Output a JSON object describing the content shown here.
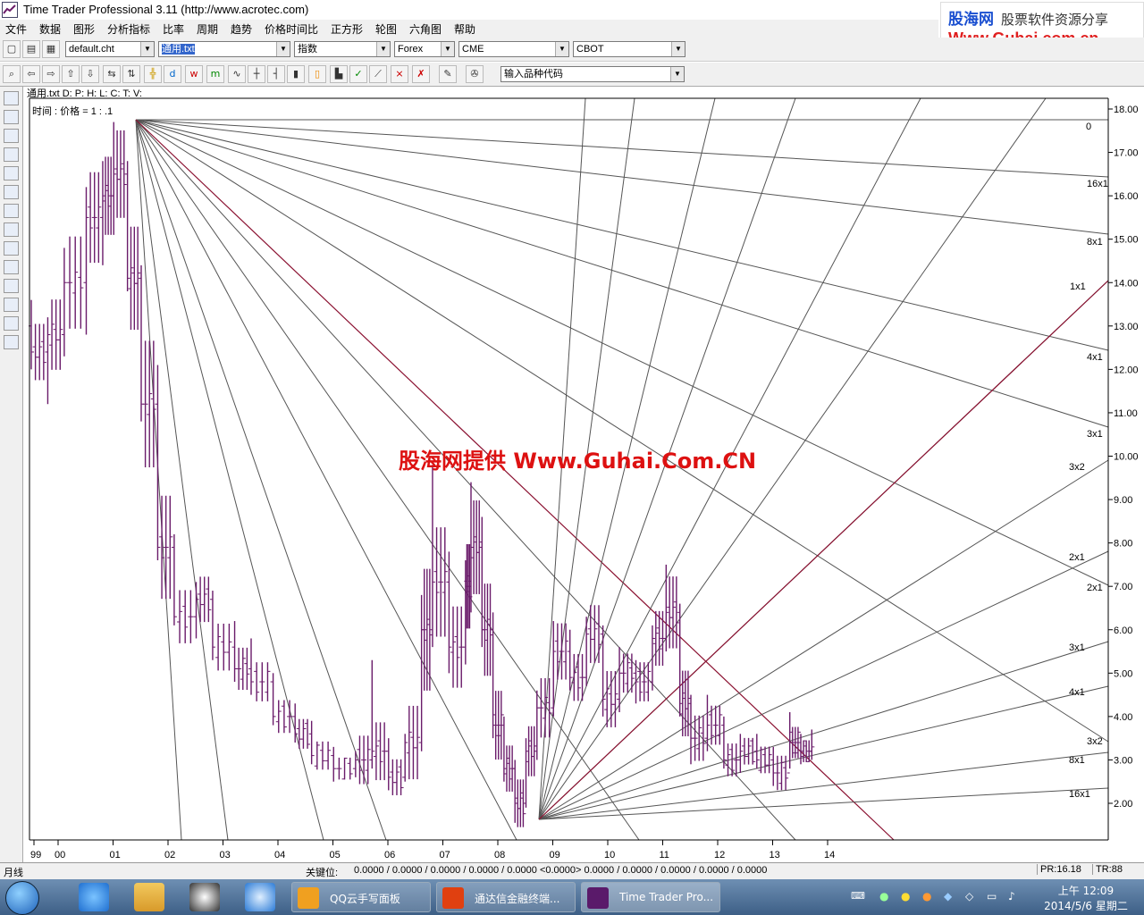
{
  "window": {
    "title": "Time Trader Professional 3.11 (http://www.acrotec.com)"
  },
  "ad": {
    "line1": "股海网",
    "line1b": "股票软件资源分享",
    "line2": "Www.Guhai.com.cn"
  },
  "menu": [
    "文件",
    "数据",
    "图形",
    "分析指标",
    "比率",
    "周期",
    "趋势",
    "价格时间比",
    "正方形",
    "轮图",
    "六角图",
    "帮助"
  ],
  "toolbar1": {
    "chart_file": "default.cht",
    "data_file": "通用.txt",
    "index": "指数",
    "market1": "Forex",
    "market2": "CME",
    "market3": "CBOT"
  },
  "toolbar2": {
    "symbol_input": "输入品种代码"
  },
  "info": {
    "data_line": "通用.txt  D:   P:   H:   L:   C:   T:   V:",
    "ratio_line": "时间 : 价格  = 1 :      .1"
  },
  "watermark": "股海网提供 Www.Guhai.Com.CN",
  "status": {
    "period": "月线",
    "key_label": "关键位:",
    "key_values": "0.0000 / 0.0000 / 0.0000 / 0.0000 / 0.0000 <0.0000> 0.0000 / 0.0000 / 0.0000 / 0.0000 / 0.0000",
    "pr": "PR:16.18",
    "tr": "TR:88"
  },
  "taskbar": {
    "tasks": [
      "QQ云手写面板",
      "通达信金融终端...",
      "Time Trader Pro..."
    ],
    "time": "上午 12:09",
    "date": "2014/5/6 星期二"
  },
  "chart_data": {
    "type": "bar",
    "y_axis_ticks": [
      "18.00",
      "17.00",
      "16.00",
      "15.00",
      "14.00",
      "13.00",
      "12.00",
      "11.00",
      "10.00",
      "9.00",
      "8.00",
      "7.00",
      "6.00",
      "5.00",
      "4.00",
      "3.00",
      "2.00"
    ],
    "ylim": [
      1.15,
      18.3
    ],
    "x_axis_ticks": [
      "99",
      "00",
      "01",
      "02",
      "03",
      "04",
      "05",
      "06",
      "07",
      "08",
      "09",
      "10",
      "11",
      "12",
      "13",
      "14"
    ],
    "gann_labels": [
      "0",
      "16x1",
      "8x1",
      "1x1",
      "4x1",
      "3x1",
      "3x2",
      "2x1",
      "2x1",
      "3x1",
      "4x1",
      "3x2",
      "8x1",
      "16x1"
    ],
    "price_series": [
      {
        "x": 0.0,
        "o": 13.0,
        "h": 13.6,
        "l": 12.0,
        "c": 12.4
      },
      {
        "x": 0.3,
        "o": 12.4,
        "h": 13.2,
        "l": 11.2,
        "c": 12.8
      },
      {
        "x": 0.6,
        "o": 12.8,
        "h": 14.8,
        "l": 12.3,
        "c": 14.0
      },
      {
        "x": 1.0,
        "o": 14.0,
        "h": 16.2,
        "l": 12.8,
        "c": 15.5
      },
      {
        "x": 1.3,
        "o": 15.5,
        "h": 16.8,
        "l": 14.4,
        "c": 16.0
      },
      {
        "x": 1.5,
        "o": 16.0,
        "h": 17.7,
        "l": 15.1,
        "c": 16.5
      },
      {
        "x": 1.75,
        "o": 16.5,
        "h": 16.8,
        "l": 13.8,
        "c": 14.1
      },
      {
        "x": 2.0,
        "o": 14.1,
        "h": 14.4,
        "l": 10.8,
        "c": 11.2
      },
      {
        "x": 2.3,
        "o": 11.2,
        "h": 12.1,
        "l": 7.6,
        "c": 7.9
      },
      {
        "x": 2.6,
        "o": 7.9,
        "h": 8.2,
        "l": 6.1,
        "c": 6.3
      },
      {
        "x": 3.0,
        "o": 6.3,
        "h": 7.1,
        "l": 5.8,
        "c": 6.7
      },
      {
        "x": 3.3,
        "o": 6.7,
        "h": 6.9,
        "l": 5.3,
        "c": 5.6
      },
      {
        "x": 3.7,
        "o": 5.6,
        "h": 6.2,
        "l": 4.8,
        "c": 5.1
      },
      {
        "x": 4.0,
        "o": 5.1,
        "h": 5.8,
        "l": 4.5,
        "c": 4.8
      },
      {
        "x": 4.4,
        "o": 4.8,
        "h": 5.0,
        "l": 3.8,
        "c": 4.0
      },
      {
        "x": 4.8,
        "o": 4.0,
        "h": 4.3,
        "l": 3.4,
        "c": 3.6
      },
      {
        "x": 5.1,
        "o": 3.6,
        "h": 3.9,
        "l": 2.9,
        "c": 3.1
      },
      {
        "x": 5.5,
        "o": 3.1,
        "h": 3.3,
        "l": 2.5,
        "c": 2.8
      },
      {
        "x": 5.9,
        "o": 2.8,
        "h": 3.2,
        "l": 2.6,
        "c": 3.0
      },
      {
        "x": 6.2,
        "o": 3.0,
        "h": 5.3,
        "l": 2.8,
        "c": 3.2
      },
      {
        "x": 6.5,
        "o": 3.2,
        "h": 3.5,
        "l": 2.3,
        "c": 2.6
      },
      {
        "x": 6.8,
        "o": 2.6,
        "h": 3.6,
        "l": 2.5,
        "c": 3.4
      },
      {
        "x": 7.1,
        "o": 3.4,
        "h": 6.8,
        "l": 3.2,
        "c": 6.0
      },
      {
        "x": 7.3,
        "o": 6.0,
        "h": 9.8,
        "l": 5.6,
        "c": 7.1
      },
      {
        "x": 7.6,
        "o": 7.1,
        "h": 7.8,
        "l": 5.0,
        "c": 5.6
      },
      {
        "x": 7.9,
        "o": 5.6,
        "h": 7.6,
        "l": 5.2,
        "c": 7.0
      },
      {
        "x": 8.0,
        "o": 7.0,
        "h": 9.4,
        "l": 6.4,
        "c": 7.9
      },
      {
        "x": 8.2,
        "o": 7.9,
        "h": 8.6,
        "l": 5.6,
        "c": 6.0
      },
      {
        "x": 8.4,
        "o": 6.0,
        "h": 6.4,
        "l": 3.5,
        "c": 3.8
      },
      {
        "x": 8.6,
        "o": 3.8,
        "h": 4.0,
        "l": 2.5,
        "c": 2.8
      },
      {
        "x": 8.8,
        "o": 2.8,
        "h": 3.0,
        "l": 1.55,
        "c": 2.0
      },
      {
        "x": 9.0,
        "o": 2.0,
        "h": 3.5,
        "l": 1.9,
        "c": 3.2
      },
      {
        "x": 9.2,
        "o": 3.2,
        "h": 4.6,
        "l": 3.0,
        "c": 4.2
      },
      {
        "x": 9.5,
        "o": 4.2,
        "h": 6.2,
        "l": 4.0,
        "c": 5.5
      },
      {
        "x": 9.8,
        "o": 5.5,
        "h": 6.0,
        "l": 4.6,
        "c": 4.9
      },
      {
        "x": 10.1,
        "o": 4.9,
        "h": 6.3,
        "l": 4.7,
        "c": 5.9
      },
      {
        "x": 10.4,
        "o": 5.9,
        "h": 6.1,
        "l": 4.0,
        "c": 4.4
      },
      {
        "x": 10.7,
        "o": 4.4,
        "h": 5.6,
        "l": 4.1,
        "c": 5.0
      },
      {
        "x": 11.0,
        "o": 5.0,
        "h": 5.3,
        "l": 4.3,
        "c": 4.8
      },
      {
        "x": 11.3,
        "o": 4.8,
        "h": 6.1,
        "l": 4.6,
        "c": 5.8
      },
      {
        "x": 11.55,
        "o": 5.8,
        "h": 7.5,
        "l": 5.5,
        "c": 6.4
      },
      {
        "x": 11.8,
        "o": 6.4,
        "h": 6.6,
        "l": 4.0,
        "c": 4.3
      },
      {
        "x": 12.0,
        "o": 4.3,
        "h": 4.5,
        "l": 2.9,
        "c": 3.5
      },
      {
        "x": 12.3,
        "o": 3.5,
        "h": 4.5,
        "l": 3.2,
        "c": 3.8
      },
      {
        "x": 12.6,
        "o": 3.8,
        "h": 4.0,
        "l": 2.8,
        "c": 3.0
      },
      {
        "x": 12.9,
        "o": 3.0,
        "h": 3.6,
        "l": 2.7,
        "c": 3.2
      },
      {
        "x": 13.2,
        "o": 3.2,
        "h": 3.6,
        "l": 2.8,
        "c": 3.0
      },
      {
        "x": 13.5,
        "o": 3.0,
        "h": 3.3,
        "l": 2.4,
        "c": 2.7
      },
      {
        "x": 13.8,
        "o": 2.7,
        "h": 4.1,
        "l": 2.8,
        "c": 3.4
      },
      {
        "x": 14.0,
        "o": 3.4,
        "h": 3.6,
        "l": 2.9,
        "c": 3.2
      },
      {
        "x": 14.2,
        "o": 3.2,
        "h": 3.7,
        "l": 3.0,
        "c": 3.3
      }
    ]
  }
}
